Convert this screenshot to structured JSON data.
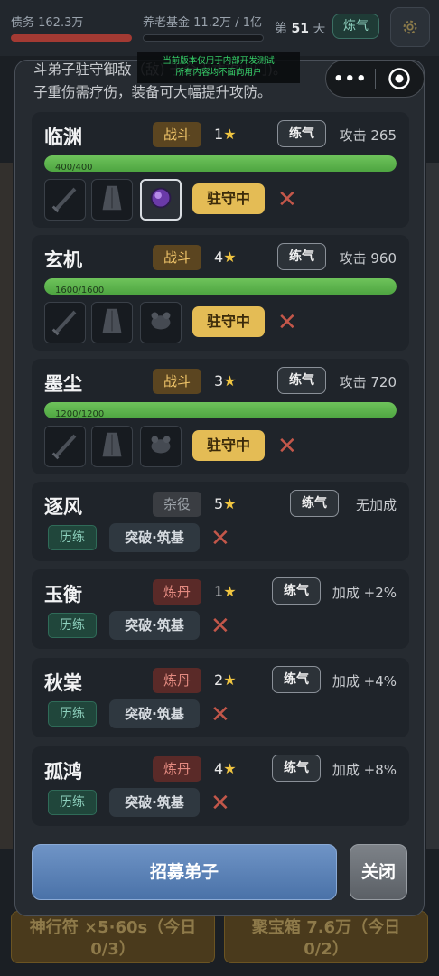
{
  "topbar": {
    "debt_label": "债务 162.3万",
    "pension_label": "养老基金 11.2万 / 1亿",
    "day_prefix": "第",
    "day_value": "51",
    "day_suffix": "天",
    "realm_badge": "炼气",
    "settings_icon": "gear-icon"
  },
  "dev_notice": {
    "line1": "当前版本仅用于内部开发测试",
    "line2": "所有内容均不面向用户"
  },
  "capsule": {
    "more_label": "•••",
    "close_icon": "target-icon"
  },
  "modal": {
    "intro_line1": "斗弟子驻守御敌（敌)                        于全灭才攻山门)。",
    "intro_line2": "子重伤需疗伤，装备可大幅提升攻防。",
    "guard_cards": [
      {
        "name": "临渊",
        "role": "战斗",
        "stars": "1",
        "realm": "练气",
        "stat": "攻击 265",
        "hp_text": "400/400",
        "hp_fraction": 1.0,
        "guard_label": "驻守中",
        "equip": [
          "weapon-icon",
          "robe-icon",
          "orb-icon"
        ]
      },
      {
        "name": "玄机",
        "role": "战斗",
        "stars": "4",
        "realm": "练气",
        "stat": "攻击 960",
        "hp_text": "1600/1600",
        "hp_fraction": 1.0,
        "guard_label": "驻守中",
        "equip": [
          "weapon-icon",
          "robe-icon",
          "beast-icon"
        ]
      },
      {
        "name": "墨尘",
        "role": "战斗",
        "stars": "3",
        "realm": "练气",
        "stat": "攻击 720",
        "hp_text": "1200/1200",
        "hp_fraction": 1.0,
        "guard_label": "驻守中",
        "equip": [
          "weapon-icon",
          "robe-icon",
          "beast-icon"
        ]
      }
    ],
    "other_cards": [
      {
        "name": "逐风",
        "role": "杂役",
        "stars": "5",
        "realm": "练气",
        "stat": "无加成",
        "train": "历练",
        "breakthrough": "突破·筑基"
      },
      {
        "name": "玉衡",
        "role": "炼丹",
        "stars": "1",
        "realm": "练气",
        "stat": "加成 +2%",
        "train": "历练",
        "breakthrough": "突破·筑基"
      },
      {
        "name": "秋棠",
        "role": "炼丹",
        "stars": "2",
        "realm": "练气",
        "stat": "加成 +4%",
        "train": "历练",
        "breakthrough": "突破·筑基"
      },
      {
        "name": "孤鸿",
        "role": "炼丹",
        "stars": "4",
        "realm": "练气",
        "stat": "加成 +8%",
        "train": "历练",
        "breakthrough": "突破·筑基"
      }
    ],
    "recruit_label": "招募弟子",
    "close_label": "关闭"
  },
  "background": {
    "btn_left_line1": "神行符 ×5·60s（今日",
    "btn_left_line2": "0/3）",
    "btn_right_line1": "聚宝箱 7.6万（今日",
    "btn_right_line2": "0/2）"
  },
  "colors": {
    "accent_gold": "#e4bc55",
    "hp_green": "#5cb44b",
    "danger_red": "#c3574a",
    "recruit_blue": "#5a80b6"
  }
}
